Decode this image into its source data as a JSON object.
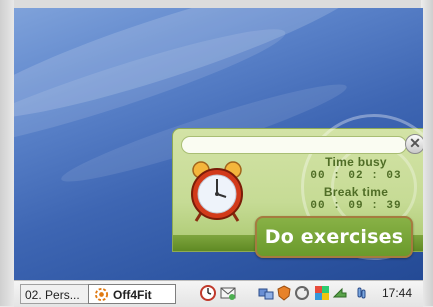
{
  "widget": {
    "time_busy_label": "Time busy",
    "time_busy_value": "00 : 02 : 03",
    "break_time_label": "Break time",
    "break_time_value": "00 : 09 : 39",
    "action_button": "Do exercises",
    "input_value": "",
    "close_symbol": "✕"
  },
  "taskbar": {
    "items": [
      {
        "label": "02. Pers..."
      },
      {
        "label": "Off4Fit",
        "active": true
      }
    ],
    "quick_launch_icons": [
      "clock-icon",
      "mail-icon"
    ],
    "tray_icons": [
      "network-icon",
      "shield-icon",
      "refresh-icon",
      "colorful-app-icon",
      "arrow-icon",
      "hand-icon"
    ],
    "clock": "17:44"
  },
  "colors": {
    "widget_green": "#c6db95",
    "text_green": "#4f6d26",
    "button_green": "#6a9a2b",
    "button_border": "#a57b3f",
    "desktop_blue": "#3e66b3"
  }
}
